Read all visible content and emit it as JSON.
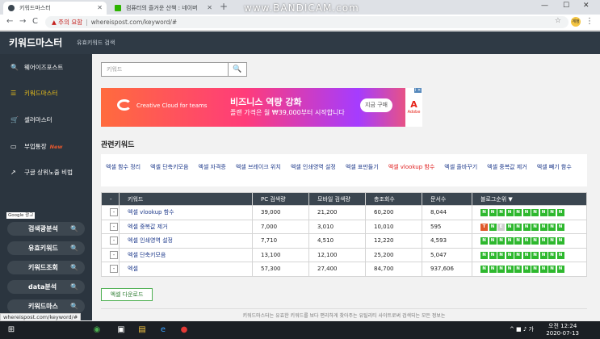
{
  "browser": {
    "tabs": [
      {
        "title": "키워드마스터",
        "active": true
      },
      {
        "title": "컴퓨터의 즐거운 산책 : 네이버",
        "active": false
      }
    ],
    "new_tab": "+",
    "watermark": "www.BANDICAM.com",
    "window_controls": {
      "minimize": "—",
      "maximize": "☐",
      "close": "✕"
    },
    "nav": {
      "back": "←",
      "forward": "→",
      "reload": "C"
    },
    "warning_icon": "▲",
    "warning": "주의 요함",
    "url": "whereispost.com/keyword/#",
    "star": "☆",
    "profile": "계정",
    "menu": "⋮"
  },
  "site": {
    "brand": "키워드마스터",
    "subtitle": "유효키워드 검색"
  },
  "sidebar": {
    "items": [
      {
        "label": "웨어이즈포스트",
        "icon": "search-icon",
        "glyph": "🔍"
      },
      {
        "label": "키워드마스터",
        "icon": "list-icon",
        "glyph": "☰"
      },
      {
        "label": "셀러마스터",
        "icon": "cart-icon",
        "glyph": "🛒"
      },
      {
        "label": "부업통장",
        "badge": "New",
        "icon": "wallet-icon",
        "glyph": "▭"
      },
      {
        "label": "구글 상위노출 비법",
        "icon": "chart-icon",
        "glyph": "↗"
      }
    ],
    "google_ad_label": "Google 광고",
    "pills": [
      {
        "label": "검색광분석"
      },
      {
        "label": "유효키워드"
      },
      {
        "label": "키워드조회"
      },
      {
        "label": "data분석"
      },
      {
        "label": "키워드마스"
      }
    ],
    "pill_icon": "🔍"
  },
  "main": {
    "search": {
      "value": "키워드",
      "button_icon": "🔍"
    },
    "ad": {
      "brand_text": "Creative Cloud for teams",
      "headline": "비즈니스 역량 강화",
      "subline": "플랜 가격은 월 ₩39,000부터 시작합니다",
      "cta": "지금 구매",
      "logo_mark": "A",
      "logo_text": "Adobe",
      "ad_tag": "i ✕"
    },
    "related_title": "관련키워드",
    "related_keywords": [
      "엑셀 함수 정리",
      "엑셀 단축키모음",
      "엑셀 자격증",
      "엑셀 브레이크 위치",
      "엑셀 인쇄영역 설정",
      "엑셀 표만들기",
      "엑셀 vlookup 함수",
      "엑셀 줄바꾸기",
      "엑셀 중복값 제거",
      "엑셀 빼기 함수"
    ],
    "related_highlight_index": 6,
    "table": {
      "headers": [
        "-",
        "키워드",
        "PC 검색량",
        "모바일 검색량",
        "총조회수",
        "문서수",
        "블로그순위 ▼"
      ],
      "rows": [
        {
          "keyword": "엑셀 vlookup 함수",
          "pc": "39,000",
          "mobile": "21,200",
          "total": "60,200",
          "docs": "8,044",
          "rank": [
            "N",
            "N",
            "N",
            "N",
            "N",
            "N",
            "N",
            "N",
            "N",
            "N"
          ]
        },
        {
          "keyword": "엑셀 중복값 제거",
          "pc": "7,000",
          "mobile": "3,010",
          "total": "10,010",
          "docs": "595",
          "rank": [
            "T",
            "N",
            "E",
            "N",
            "N",
            "N",
            "N",
            "N",
            "N",
            "N"
          ]
        },
        {
          "keyword": "엑셀 인쇄영역 설정",
          "pc": "7,710",
          "mobile": "4,510",
          "total": "12,220",
          "docs": "4,593",
          "rank": [
            "N",
            "N",
            "N",
            "N",
            "N",
            "N",
            "N",
            "N",
            "N",
            "N"
          ]
        },
        {
          "keyword": "엑셀 단축키모음",
          "pc": "13,100",
          "mobile": "12,100",
          "total": "25,200",
          "docs": "5,047",
          "rank": [
            "N",
            "N",
            "N",
            "N",
            "N",
            "N",
            "N",
            "N",
            "N",
            "N"
          ]
        },
        {
          "keyword": "엑셀",
          "pc": "57,300",
          "mobile": "27,400",
          "total": "84,700",
          "docs": "937,606",
          "rank": [
            "N",
            "N",
            "N",
            "N",
            "N",
            "N",
            "N",
            "N",
            "N",
            "N"
          ]
        }
      ],
      "row_button": "-"
    },
    "download_button": "엑셀 다운로드",
    "footer": "키워드마스터는 유효한 키워드를 보다 편리하게 찾아주는 유틸리티 사이트로써 검색되는 모든 정보는"
  },
  "status_url": "whereispost.com/keyword/#",
  "taskbar": {
    "start": "⊞",
    "icons": [
      "◉",
      "▣",
      "▤",
      "e",
      "●"
    ],
    "tray": "^ ■ ♪ 가",
    "time": "오전 12:24",
    "date": "2020-07-13"
  },
  "colors": {
    "sidebar_bg": "#2b353f",
    "header_bg": "#2f3a45",
    "accent_yellow": "#f0c419",
    "rank_green": "#2eb82e",
    "rank_orange": "#e05a2b"
  }
}
